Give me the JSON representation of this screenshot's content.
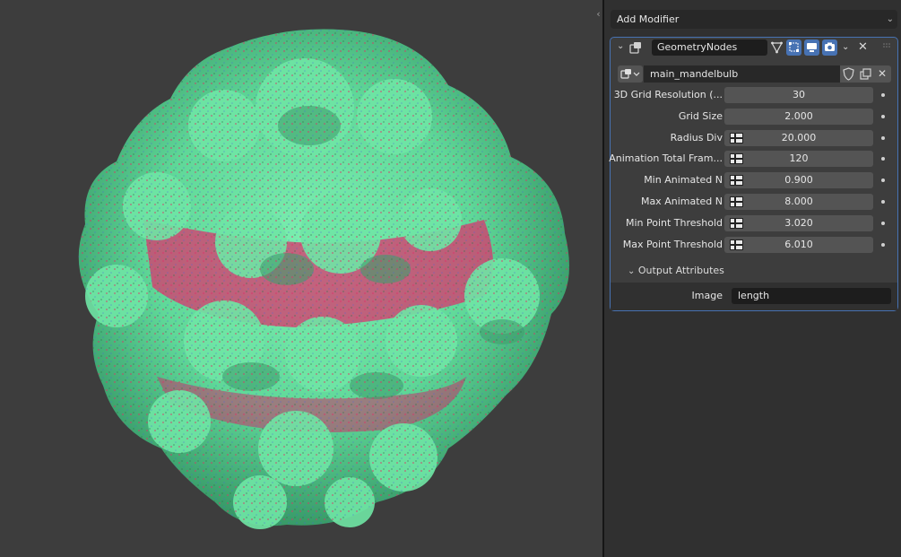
{
  "panel": {
    "add_modifier": "Add Modifier",
    "modifier_name": "GeometryNodes",
    "node_tree": "main_mandelbulb"
  },
  "inputs": [
    {
      "label": "3D Grid Resolution (...",
      "value": "30",
      "attribute_toggle": false
    },
    {
      "label": "Grid Size",
      "value": "2.000",
      "attribute_toggle": false
    },
    {
      "label": "Radius Div",
      "value": "20.000",
      "attribute_toggle": true
    },
    {
      "label": "Animation Total Fram...",
      "value": "120",
      "attribute_toggle": true
    },
    {
      "label": "Min Animated N",
      "value": "0.900",
      "attribute_toggle": true
    },
    {
      "label": "Max Animated N",
      "value": "8.000",
      "attribute_toggle": true
    },
    {
      "label": "Min Point Threshold",
      "value": "3.020",
      "attribute_toggle": true
    },
    {
      "label": "Max Point Threshold",
      "value": "6.010",
      "attribute_toggle": true
    }
  ],
  "output_attributes": {
    "header": "Output Attributes",
    "image_label": "Image",
    "image_value": "length"
  },
  "colors": {
    "accent": "#4772b3",
    "fractal_green": "#5fd898",
    "fractal_pink": "#e0306a"
  },
  "icons": [
    "modifier-geometry-icon",
    "edit-mode-icon",
    "realtime-icon",
    "render-icon",
    "close-icon",
    "fake-user-icon",
    "duplicate-icon"
  ]
}
